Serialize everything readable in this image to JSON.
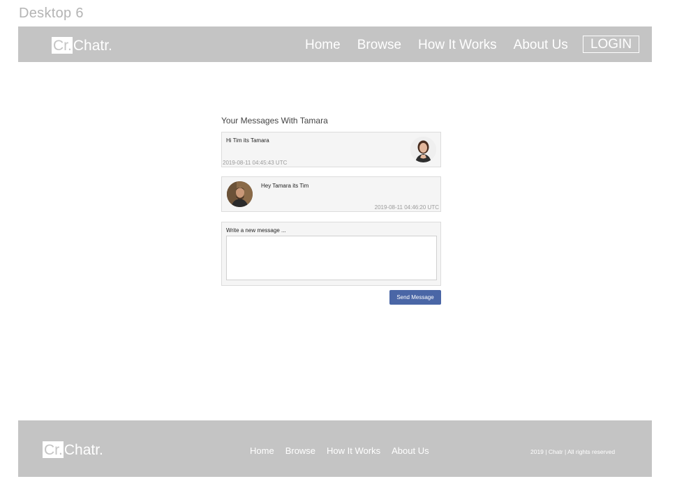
{
  "frame_label": "Desktop 6",
  "header": {
    "logo_box": "Cr.",
    "logo_text": "Chatr.",
    "nav": [
      "Home",
      "Browse",
      "How It Works",
      "About Us"
    ],
    "login_label": "LOGIN"
  },
  "thread": {
    "title": "Your Messages With Tamara",
    "messages": [
      {
        "text": "Hi Tim its Tamara",
        "timestamp": "2019-08-11 04:45:43 UTC",
        "avatar": "tamara-avatar"
      },
      {
        "text": "Hey Tamara its Tim",
        "timestamp": "2019-08-11 04:46:20 UTC",
        "avatar": "tim-avatar"
      }
    ]
  },
  "compose": {
    "label": "Write a new message ...",
    "value": "",
    "send_label": "Send Message"
  },
  "footer": {
    "logo_box": "Cr.",
    "logo_text": "Chatr.",
    "nav": [
      "Home",
      "Browse",
      "How It Works",
      "About Us"
    ],
    "copyright": "2019 | Chatr | All rights reserved"
  },
  "colors": {
    "bar_gray": "#c4c4c4",
    "send_button": "#4a66a6",
    "message_bg": "#f5f5f5"
  }
}
